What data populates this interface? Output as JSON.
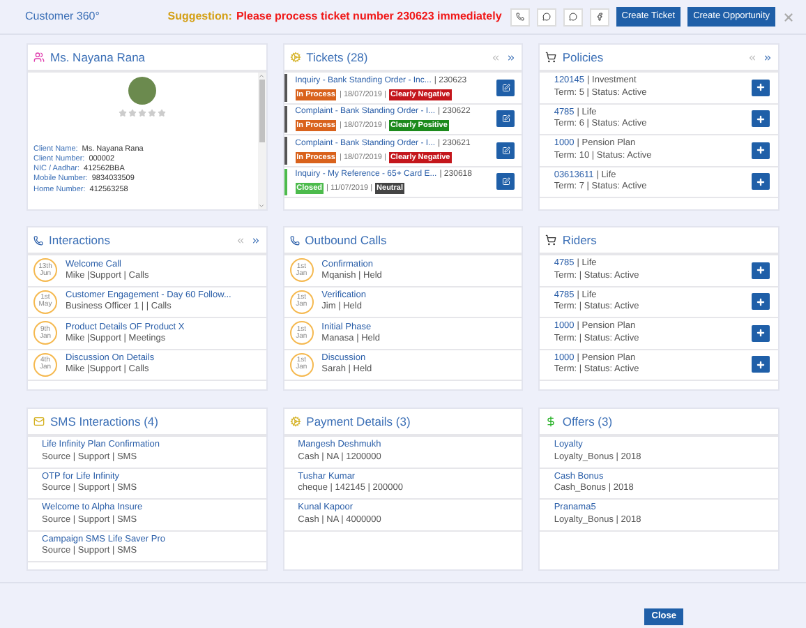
{
  "header": {
    "title": "Customer 360°",
    "suggestion_label": "Suggestion:",
    "suggestion_text": "Please process ticket number 230623 immediately",
    "buttons": [
      "Create Ticket",
      "Create Opportunity"
    ]
  },
  "profile": {
    "name": "Ms. Nayana Rana",
    "stars": 0,
    "fields": [
      {
        "label": "Client Name:",
        "value": "Ms. Nayana Rana"
      },
      {
        "label": "Client Number:",
        "value": "000002"
      },
      {
        "label": "NIC / Aadhar:",
        "value": "412562BBA"
      },
      {
        "label": "Mobile Number:",
        "value": "9834033509"
      },
      {
        "label": "Home Number:",
        "value": "412563258"
      }
    ]
  },
  "tickets": {
    "title": "Tickets (28)",
    "items": [
      {
        "title": "Inquiry - Bank Standing Order - Inc...",
        "number": "| 230623",
        "color": "#555555",
        "status": {
          "text": "In Process",
          "color": "#d9621c"
        },
        "date": "| 18/07/2019 |",
        "sentiment": {
          "text": "Clearly Negative",
          "color": "#c4161c"
        }
      },
      {
        "title": "Complaint - Bank Standing Order - I...",
        "number": "| 230622",
        "color": "#555555",
        "status": {
          "text": "In Process",
          "color": "#d9621c"
        },
        "date": "| 18/07/2019 |",
        "sentiment": {
          "text": "Clearly Positive",
          "color": "#1c8a1c"
        }
      },
      {
        "title": "Complaint - Bank Standing Order - I...",
        "number": "| 230621",
        "color": "#555555",
        "status": {
          "text": "In Process",
          "color": "#d9621c"
        },
        "date": "| 18/07/2019 |",
        "sentiment": {
          "text": "Clearly Negative",
          "color": "#c4161c"
        }
      },
      {
        "title": "Inquiry - My Reference - 65+ Card E...",
        "number": "| 230618",
        "color": "#4cbb4c",
        "status": {
          "text": "Closed",
          "color": "#4cbb4c"
        },
        "date": "| 11/07/2019 |",
        "sentiment": {
          "text": "Neutral",
          "color": "#444444"
        }
      }
    ]
  },
  "policies": {
    "title": "Policies",
    "items": [
      {
        "number": "120145",
        "type": "| Investment",
        "details": "Term: 5 | Status: Active"
      },
      {
        "number": "4785",
        "type": "| Life",
        "details": "Term: 6 | Status: Active"
      },
      {
        "number": "1000",
        "type": "| Pension Plan",
        "details": "Term: 10 | Status: Active"
      },
      {
        "number": "03613611",
        "type": "| Life",
        "details": "Term: 7 | Status: Active"
      }
    ]
  },
  "interactions": {
    "title": "Interactions",
    "items": [
      {
        "day": "13th",
        "month": "Jun",
        "title": "Welcome Call",
        "details": "Mike |Support | Calls"
      },
      {
        "day": "1st",
        "month": "May",
        "title": "Customer Engagement - Day 60 Follow...",
        "details": "Business Officer 1 | | Calls"
      },
      {
        "day": "9th",
        "month": "Jan",
        "title": "Product Details OF Product X",
        "details": "Mike |Support | Meetings"
      },
      {
        "day": "4th",
        "month": "Jan",
        "title": "Discussion On Details",
        "details": "Mike |Support | Calls"
      }
    ]
  },
  "outbound_calls": {
    "title": "Outbound Calls",
    "items": [
      {
        "day": "1st",
        "month": "Jan",
        "title": "Confirmation",
        "details": "Mqanish | Held"
      },
      {
        "day": "1st",
        "month": "Jan",
        "title": "Verification",
        "details": "Jim | Held"
      },
      {
        "day": "1st",
        "month": "Jan",
        "title": "Initial Phase",
        "details": "Manasa | Held"
      },
      {
        "day": "1st",
        "month": "Jan",
        "title": "Discussion",
        "details": "Sarah | Held"
      }
    ]
  },
  "riders": {
    "title": "Riders",
    "items": [
      {
        "number": "4785",
        "type": "| Life",
        "details": "Term: | Status: Active"
      },
      {
        "number": "4785",
        "type": "| Life",
        "details": "Term: | Status: Active"
      },
      {
        "number": "1000",
        "type": "| Pension Plan",
        "details": "Term: | Status: Active"
      },
      {
        "number": "1000",
        "type": "| Pension Plan",
        "details": "Term: | Status: Active"
      }
    ]
  },
  "sms": {
    "title": "SMS Interactions (4)",
    "items": [
      {
        "title": "Life Infinity Plan Confirmation",
        "details": "Source | Support | SMS"
      },
      {
        "title": "OTP for Life Infinity",
        "details": "Source | Support | SMS"
      },
      {
        "title": "Welcome to Alpha Insure",
        "details": "Source | Support | SMS"
      },
      {
        "title": "Campaign SMS Life Saver Pro",
        "details": "Source | Support | SMS"
      }
    ]
  },
  "payments": {
    "title": "Payment Details (3)",
    "items": [
      {
        "title": "Mangesh Deshmukh",
        "details": "Cash | NA | 1200000"
      },
      {
        "title": "Tushar Kumar",
        "details": "cheque | 142145 | 200000"
      },
      {
        "title": "Kunal Kapoor",
        "details": "Cash | NA | 4000000"
      }
    ]
  },
  "offers": {
    "title": "Offers (3)",
    "items": [
      {
        "title": "Loyalty",
        "details": "Loyalty_Bonus | 2018"
      },
      {
        "title": "Cash Bonus",
        "details": "Cash_Bonus | 2018"
      },
      {
        "title": "Pranama5",
        "details": "Loyalty_Bonus | 2018"
      }
    ]
  },
  "footer": {
    "button": "Close"
  }
}
